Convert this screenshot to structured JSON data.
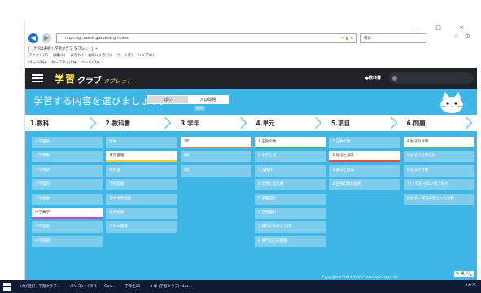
{
  "window": {
    "controls": "– □ ×"
  },
  "browser": {
    "address": "https://gc.tablet.gakuweb.gr/index/",
    "address_controls": "▾ 🔒 C",
    "search_placeholder": "検索...",
    "right_icons": "☆ ⚙",
    "tab_label": "げびほ選択 | 学習クラブ タブレ...",
    "menu": [
      "ファイル(F)",
      "編集(E)",
      "表示(V)",
      "お気に入り(A)",
      "ツール(T)",
      "ヘルプ(H)"
    ],
    "commands": [
      "ページ(P)▾",
      "セーフティ(S)▾",
      "ツール(O)▾"
    ]
  },
  "app": {
    "logo_main": "学習",
    "logo_club": "クラブ",
    "logo_tablet": "タブレット",
    "header_badge": "●教科書"
  },
  "main": {
    "prompt": "学習する内容を選びましょう。",
    "toggle": {
      "left": "ぱり",
      "right": "入試問題"
    },
    "toggle_hint": "教科"
  },
  "steps": [
    "1.教科",
    "2.教科書",
    "3.学年",
    "4.単元",
    "5.項目",
    "6.問題"
  ],
  "columns": [
    {
      "items": [
        "小学国語",
        "小学算数",
        "小学英語",
        "小学理科",
        "小学社会",
        "中学数学",
        "中学国語",
        "中学英語"
      ],
      "selected": 5
    },
    {
      "items": [
        "啓林",
        "東京書籍",
        "教科書",
        "学校図書",
        "日本文教出版",
        "教育出版",
        "大日本図書"
      ],
      "selected": 1
    },
    {
      "items": [
        "1年",
        "2年",
        "3年"
      ],
      "selected": 0
    },
    {
      "items": [
        "1 正負の数",
        "2 文字と式",
        "3 方程式",
        "4 比例と反比例",
        "5 平面図形",
        "6 空間図形",
        "7 資料の分析と活用",
        "8 平行四辺形面積"
      ],
      "selected": 0
    },
    {
      "items": [
        "1 正負の数",
        "2 加法と減法",
        "3 乗法と除法",
        "4 正負の数の利用"
      ],
      "selected": 1
    },
    {
      "items": [
        "4 加法の計算",
        "5 加法の計算法則",
        "6 減法の計算",
        "7 ( ) を取らない式で表す",
        "8 加法・減法の混じった計算"
      ],
      "selected": 0
    }
  ],
  "footer": {
    "copyright": "Copyright © 2014-2020 Cosmotopia Japan Inc.",
    "float_buttons": "✎ A 🔍"
  },
  "taskbar": {
    "tasks": [
      "げび選択 | 学習クラブ...",
      "パソコン イラスト - Goo...",
      "学年生23",
      "3 年 (学習クラブ) .doc..."
    ],
    "clock": "14:25"
  },
  "colors": {
    "accent": "#3fb7e6",
    "header": "#1f2226",
    "logo": "#ffe14d"
  }
}
